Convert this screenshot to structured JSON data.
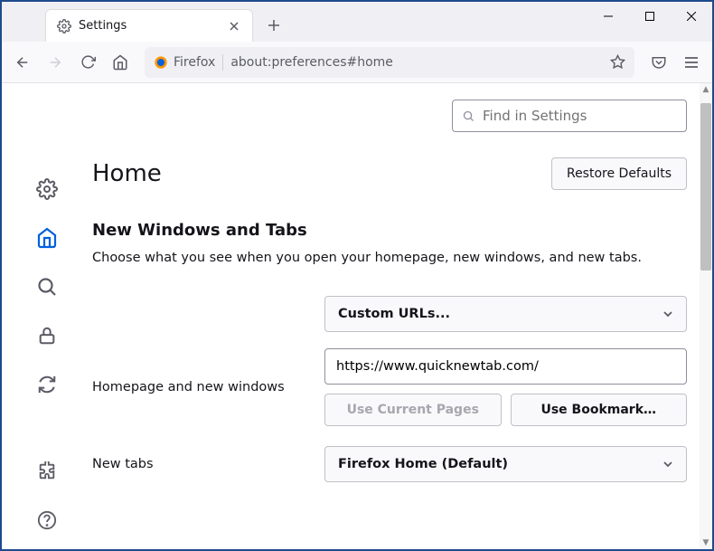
{
  "window": {
    "tab_title": "Settings"
  },
  "urlbar": {
    "identity": "Firefox",
    "url": "about:preferences#home"
  },
  "search": {
    "placeholder": "Find in Settings"
  },
  "page": {
    "title": "Home",
    "restore_defaults": "Restore Defaults"
  },
  "section": {
    "title": "New Windows and Tabs",
    "desc": "Choose what you see when you open your homepage, new windows, and new tabs."
  },
  "form": {
    "homepage_label": "Homepage and new windows",
    "homepage_select": "Custom URLs...",
    "homepage_value": "https://www.quicknewtab.com/",
    "use_current": "Use Current Pages",
    "use_bookmark": "Use Bookmark…",
    "newtabs_label": "New tabs",
    "newtabs_select": "Firefox Home (Default)"
  }
}
